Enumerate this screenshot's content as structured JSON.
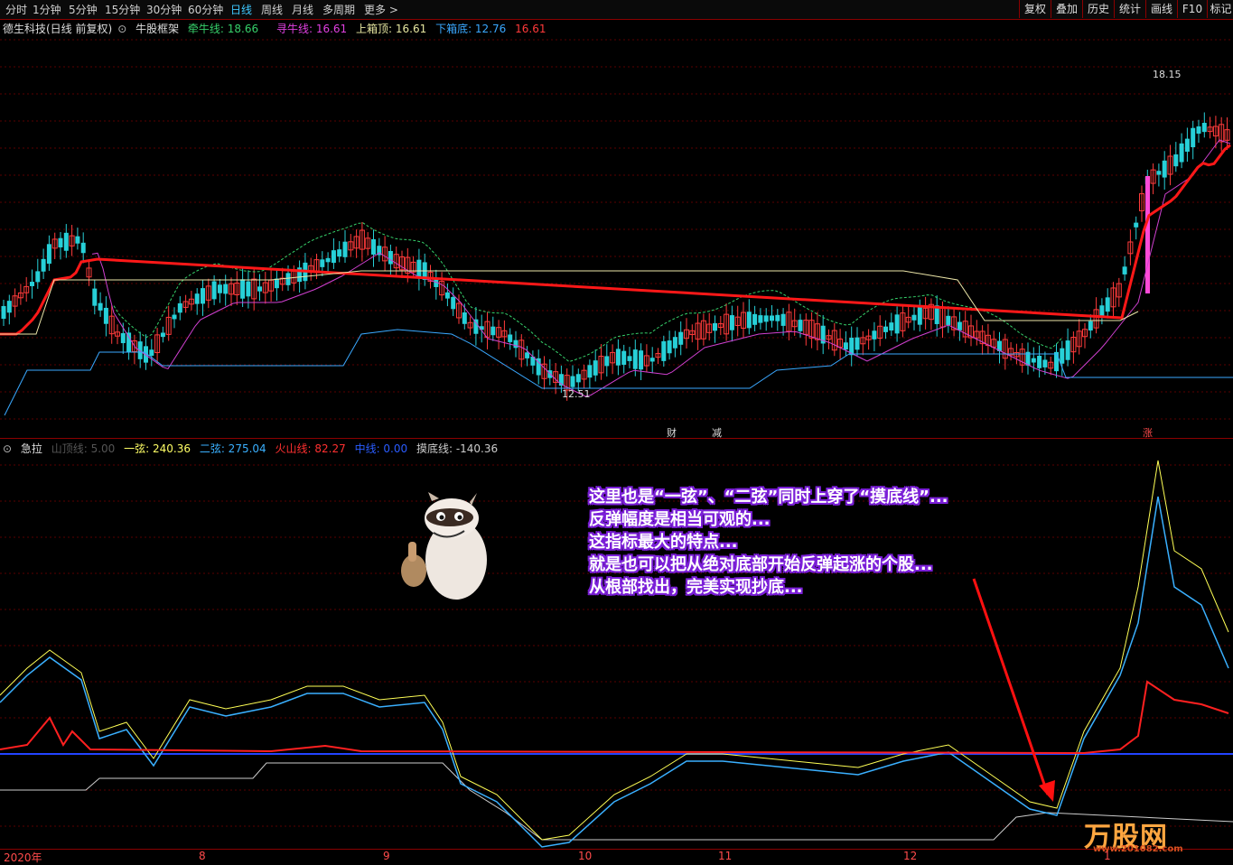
{
  "toolbar": {
    "periods": [
      "分时",
      "1分钟",
      "5分钟",
      "15分钟",
      "30分钟",
      "60分钟",
      "日线",
      "周线",
      "月线",
      "多周期",
      "更多"
    ],
    "active_period": "日线",
    "buttons": [
      "复权",
      "叠加",
      "历史",
      "统计",
      "画线",
      "F10",
      "标记"
    ]
  },
  "main_pane": {
    "stock_title": "德生科技(日线 前复权)",
    "indicator_name": "牛股框架",
    "lines": [
      {
        "label": "牵牛线: 18.66",
        "color": "#36d06a"
      },
      {
        "label": "寻牛线: 16.61",
        "color": "#e040e0"
      },
      {
        "label": "上箱顶: 16.61",
        "color": "#e6e6a0"
      },
      {
        "label": "下箱底: 12.76",
        "color": "#3aa8ff"
      },
      {
        "label": "16.61",
        "color": "#ff3a3a"
      }
    ],
    "high_label": "18.15",
    "low_label": "12.51",
    "flags": [
      {
        "text": "财",
        "color": "#dddddd"
      },
      {
        "text": "减",
        "color": "#dddddd"
      },
      {
        "text": "涨",
        "color": "#ff4b4b"
      }
    ]
  },
  "sub_pane": {
    "indicator_name": "急拉",
    "lines": [
      {
        "label": "山顶线: 5.00",
        "color": "#555555"
      },
      {
        "label": "一弦: 240.36",
        "color": "#ffff66"
      },
      {
        "label": "二弦: 275.04",
        "color": "#3ab0ff"
      },
      {
        "label": "火山线: 82.27",
        "color": "#ff3030"
      },
      {
        "label": "中线: 0.00",
        "color": "#2a5cff"
      },
      {
        "label": "摸底线: -140.36",
        "color": "#cccccc"
      }
    ]
  },
  "annotation": [
    "这里也是“一弦”、“二弦”同时上穿了“摸底线”...",
    "反弹幅度是相当可观的...",
    "这指标最大的特点...",
    "就是也可以把从绝对底部开始反弹起涨的个股...",
    "从根部找出，完美实现抄底..."
  ],
  "x_axis": [
    "2020年",
    "8",
    "9",
    "10",
    "11",
    "12",
    "1"
  ],
  "watermark": {
    "brand": "万股网",
    "url": "www.201082.com"
  }
}
